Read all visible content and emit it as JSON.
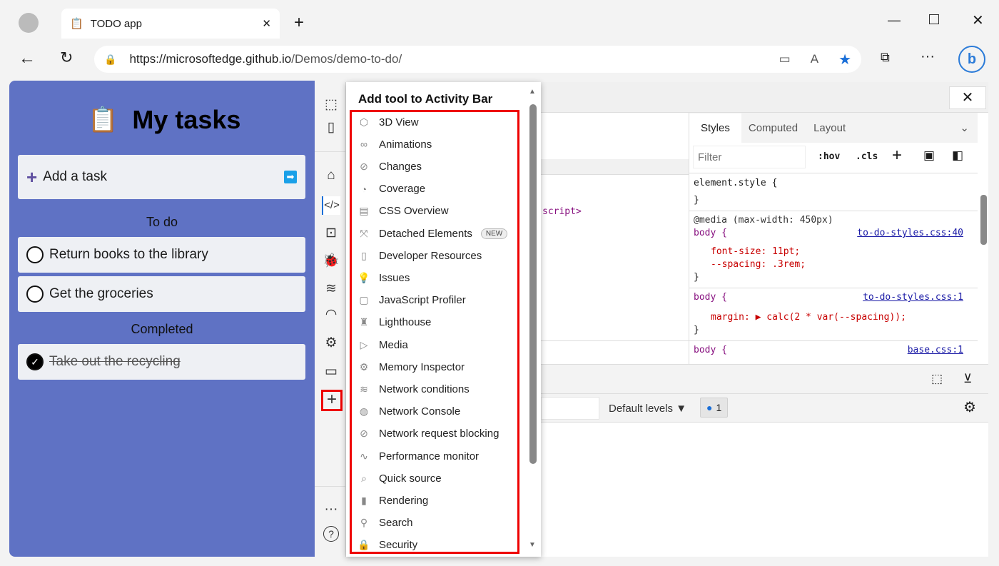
{
  "browser": {
    "tab_title": "TODO app",
    "url_host": "https://microsoftedge.github.io",
    "url_path": "/Demos/demo-to-do/"
  },
  "app": {
    "title": "My tasks",
    "add_task": "Add a task",
    "todo_heading": "To do",
    "todo": [
      "Return books to the library",
      "Get the groceries"
    ],
    "completed_heading": "Completed",
    "completed": [
      "Take out the recycling"
    ],
    "accent": "#5f72c4"
  },
  "popup": {
    "title": "Add tool to Activity Bar",
    "items": [
      {
        "label": "3D View",
        "icon": "cube-icon"
      },
      {
        "label": "Animations",
        "icon": "animation-icon"
      },
      {
        "label": "Changes",
        "icon": "changes-icon"
      },
      {
        "label": "Coverage",
        "icon": "coverage-icon"
      },
      {
        "label": "CSS Overview",
        "icon": "css-overview-icon"
      },
      {
        "label": "Detached Elements",
        "icon": "detached-icon",
        "badge": "NEW"
      },
      {
        "label": "Developer Resources",
        "icon": "document-icon"
      },
      {
        "label": "Issues",
        "icon": "bulb-icon"
      },
      {
        "label": "JavaScript Profiler",
        "icon": "js-icon"
      },
      {
        "label": "Lighthouse",
        "icon": "lighthouse-icon"
      },
      {
        "label": "Media",
        "icon": "play-icon"
      },
      {
        "label": "Memory Inspector",
        "icon": "memory-icon"
      },
      {
        "label": "Network conditions",
        "icon": "wifi-gear-icon"
      },
      {
        "label": "Network Console",
        "icon": "globe-icon"
      },
      {
        "label": "Network request blocking",
        "icon": "block-icon"
      },
      {
        "label": "Performance monitor",
        "icon": "pulse-icon"
      },
      {
        "label": "Quick source",
        "icon": "quick-source-icon"
      },
      {
        "label": "Rendering",
        "icon": "brush-icon"
      },
      {
        "label": "Search",
        "icon": "search-icon"
      },
      {
        "label": "Security",
        "icon": "lock-icon"
      }
    ]
  },
  "elements": {
    "snippet": "script>"
  },
  "styles": {
    "tabs": [
      "Styles",
      "Computed",
      "Layout"
    ],
    "filter_placeholder": "Filter",
    "hov": ":hov",
    "cls": ".cls",
    "rules": [
      {
        "selector": "element.style {",
        "close": "}"
      },
      {
        "media": "@media (max-width: 450px)",
        "selector": "body {",
        "source": "to-do-styles.css:40",
        "props": [
          "font-size: 11pt;",
          "--spacing: .3rem;"
        ],
        "close": "}"
      },
      {
        "selector": "body {",
        "source": "to-do-styles.css:1",
        "props": [
          "margin: ▶ calc(2 * var(--spacing));"
        ],
        "close": "}"
      },
      {
        "selector": "body {",
        "source": "base.css:1"
      }
    ]
  },
  "console": {
    "levels": "Default levels",
    "issues_count": "1"
  }
}
